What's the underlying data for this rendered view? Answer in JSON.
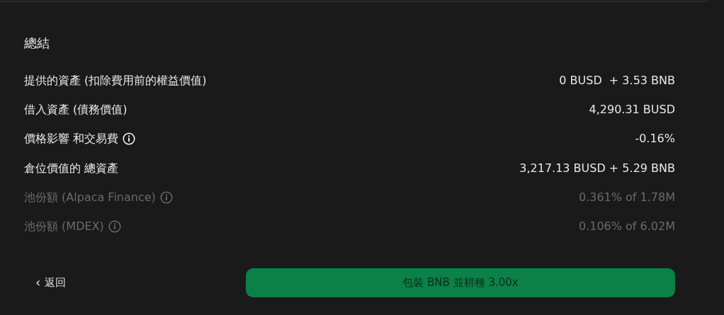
{
  "title": "總結",
  "rows": [
    {
      "label": "提供的資產 (扣除費用前的權益價值)",
      "value": "0 BUSD  + 3.53 BNB",
      "info": false,
      "muted": false
    },
    {
      "label": "借入資產 (債務價值)",
      "value": "4,290.31 BUSD",
      "info": false,
      "muted": false
    },
    {
      "label": "價格影響 和交易費",
      "value": "-0.16%",
      "info": true,
      "muted": false
    },
    {
      "label": "倉位價值的 總資產",
      "value": "3,217.13 BUSD + 5.29 BNB",
      "info": false,
      "muted": false
    },
    {
      "label": "池份額 (Alpaca Finance)",
      "value": "0.361% of 1.78M",
      "info": true,
      "muted": true
    },
    {
      "label": "池份額 (MDEX)",
      "value": "0.106% of 6.02M",
      "info": true,
      "muted": true
    }
  ],
  "back": {
    "icon": "‹",
    "label": "返回"
  },
  "submit": "包裝 BNB 並耕種 3.00x"
}
